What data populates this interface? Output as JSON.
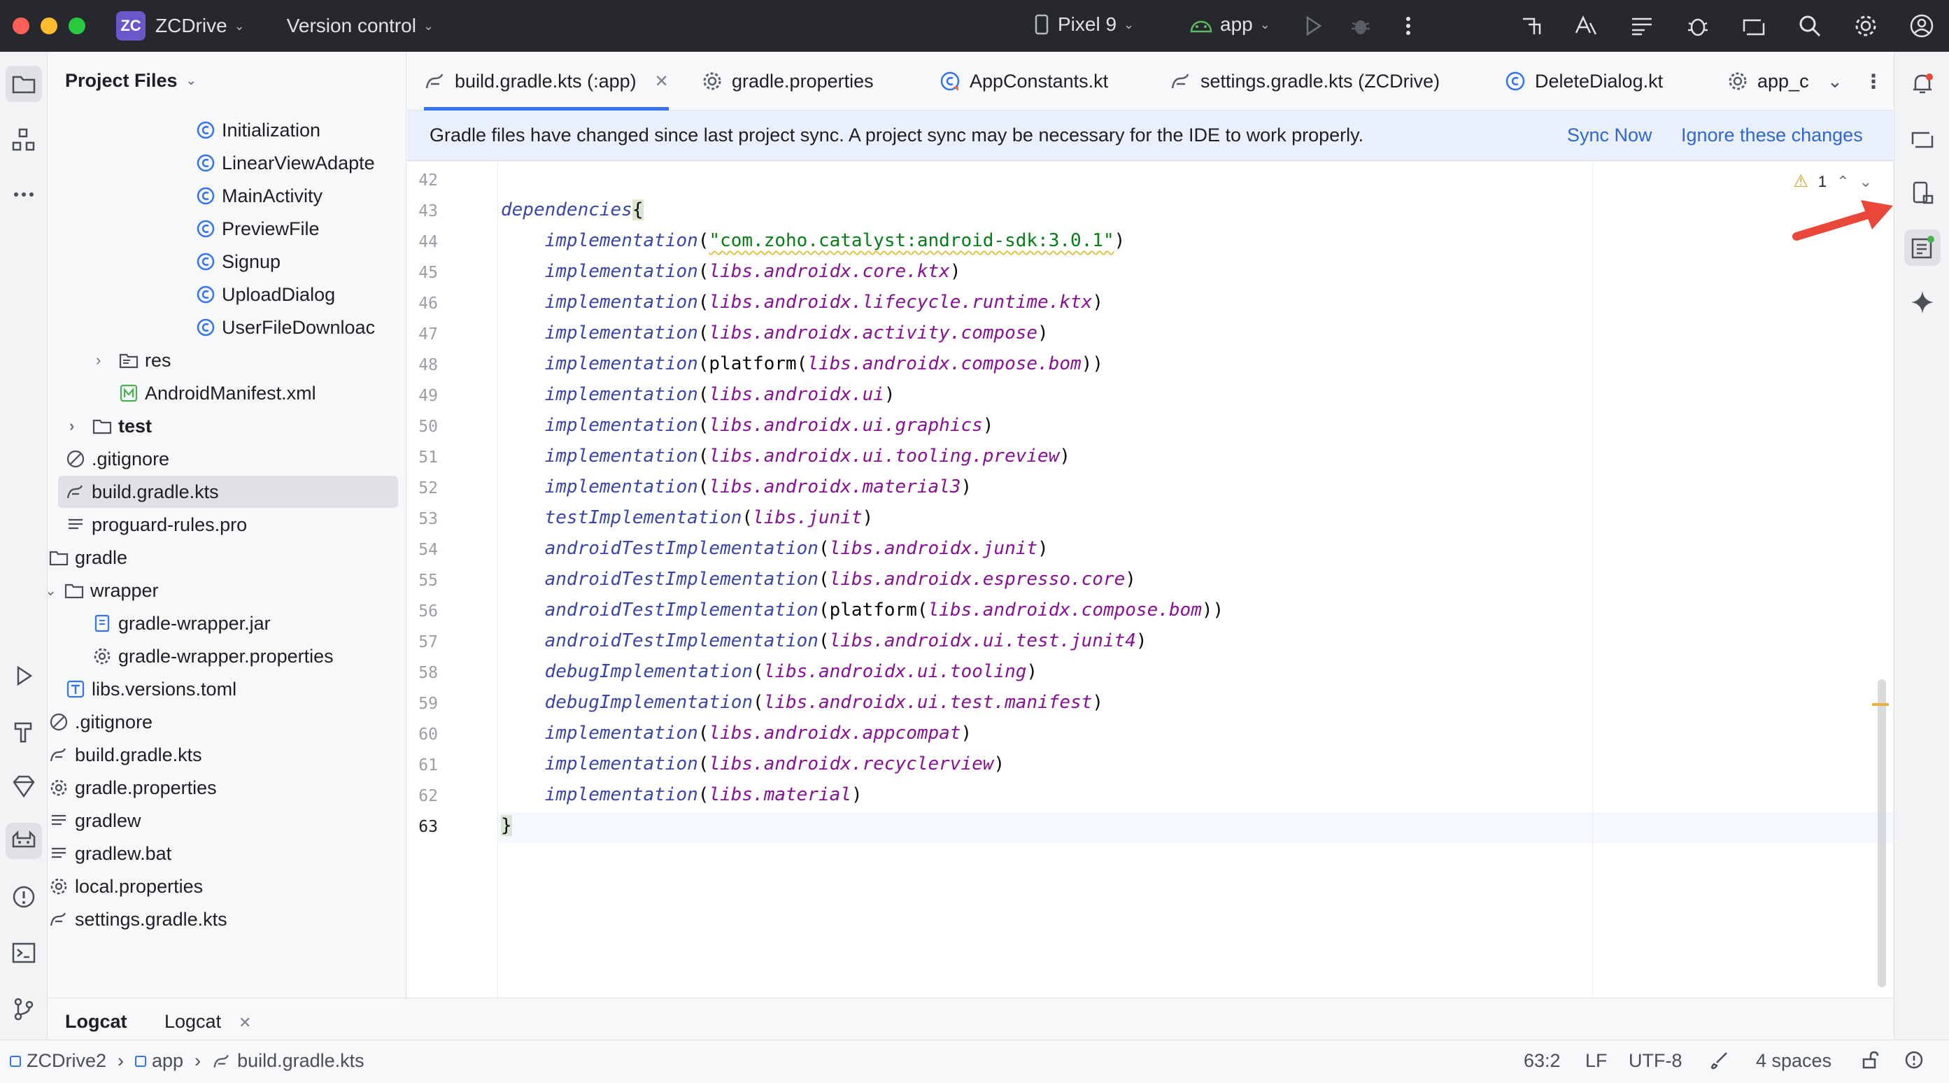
{
  "titlebar": {
    "project_badge": "ZC",
    "project_name": "ZCDrive",
    "vcs_label": "Version control",
    "device": "Pixel 9",
    "run_config": "app"
  },
  "project_panel": {
    "title": "Project Files",
    "tree": [
      {
        "label": "Initialization",
        "icon": "kotlin-class-icon"
      },
      {
        "label": "LinearViewAdapte",
        "icon": "kotlin-class-icon"
      },
      {
        "label": "MainActivity",
        "icon": "kotlin-class-icon"
      },
      {
        "label": "PreviewFile",
        "icon": "kotlin-class-icon"
      },
      {
        "label": "Signup",
        "icon": "kotlin-class-icon"
      },
      {
        "label": "UploadDialog",
        "icon": "kotlin-class-icon"
      },
      {
        "label": "UserFileDownloac",
        "icon": "kotlin-class-icon"
      },
      {
        "label": "res",
        "icon": "resource-folder-icon"
      },
      {
        "label": "AndroidManifest.xml",
        "icon": "manifest-icon"
      },
      {
        "label": "test",
        "icon": "folder-icon"
      },
      {
        "label": ".gitignore",
        "icon": "ignore-file-icon"
      },
      {
        "label": "build.gradle.kts",
        "icon": "gradle-icon"
      },
      {
        "label": "proguard-rules.pro",
        "icon": "text-file-icon"
      },
      {
        "label": "gradle",
        "icon": "folder-icon"
      },
      {
        "label": "wrapper",
        "icon": "folder-icon"
      },
      {
        "label": "gradle-wrapper.jar",
        "icon": "jar-icon"
      },
      {
        "label": "gradle-wrapper.properties",
        "icon": "gear-icon"
      },
      {
        "label": "libs.versions.toml",
        "icon": "toml-icon"
      },
      {
        "label": ".gitignore",
        "icon": "ignore-file-icon"
      },
      {
        "label": "build.gradle.kts",
        "icon": "gradle-icon"
      },
      {
        "label": "gradle.properties",
        "icon": "gear-icon"
      },
      {
        "label": "gradlew",
        "icon": "text-file-icon"
      },
      {
        "label": "gradlew.bat",
        "icon": "text-file-icon"
      },
      {
        "label": "local.properties",
        "icon": "gear-icon"
      },
      {
        "label": "settings.gradle.kts",
        "icon": "gradle-icon"
      }
    ]
  },
  "tabs": [
    {
      "label": "build.gradle.kts (:app)",
      "active": true
    },
    {
      "label": "gradle.properties"
    },
    {
      "label": "AppConstants.kt"
    },
    {
      "label": "settings.gradle.kts (ZCDrive)"
    },
    {
      "label": "DeleteDialog.kt"
    },
    {
      "label": "app_c"
    }
  ],
  "banner": {
    "message": "Gradle files have changed since last project sync. A project sync may be necessary for the IDE to work properly.",
    "sync_now": "Sync Now",
    "ignore": "Ignore these changes"
  },
  "editor": {
    "warning_count": "1",
    "lines": [
      {
        "n": "42",
        "parts": []
      },
      {
        "n": "43",
        "parts": [
          [
            "kw",
            "dependencies"
          ],
          [
            "hl",
            "{"
          ]
        ]
      },
      {
        "n": "44",
        "parts": [
          [
            "i",
            "    "
          ],
          [
            "kw",
            "implementation"
          ],
          [
            "p",
            "("
          ],
          [
            "str",
            "\"com.zoho.catalyst:android-sdk:3.0.1\""
          ],
          [
            "p",
            ")"
          ]
        ]
      },
      {
        "n": "45",
        "parts": [
          [
            "i",
            "    "
          ],
          [
            "kw",
            "implementation"
          ],
          [
            "p",
            "("
          ],
          [
            "prop",
            "libs.androidx.core.ktx"
          ],
          [
            "p",
            ")"
          ]
        ]
      },
      {
        "n": "46",
        "parts": [
          [
            "i",
            "    "
          ],
          [
            "kw",
            "implementation"
          ],
          [
            "p",
            "("
          ],
          [
            "prop",
            "libs.androidx.lifecycle.runtime.ktx"
          ],
          [
            "p",
            ")"
          ]
        ]
      },
      {
        "n": "47",
        "parts": [
          [
            "i",
            "    "
          ],
          [
            "kw",
            "implementation"
          ],
          [
            "p",
            "("
          ],
          [
            "prop",
            "libs.androidx.activity.compose"
          ],
          [
            "p",
            ")"
          ]
        ]
      },
      {
        "n": "48",
        "parts": [
          [
            "i",
            "    "
          ],
          [
            "kw",
            "implementation"
          ],
          [
            "p",
            "(platform("
          ],
          [
            "prop",
            "libs.androidx.compose.bom"
          ],
          [
            "p",
            "))"
          ]
        ]
      },
      {
        "n": "49",
        "parts": [
          [
            "i",
            "    "
          ],
          [
            "kw",
            "implementation"
          ],
          [
            "p",
            "("
          ],
          [
            "prop",
            "libs.androidx.ui"
          ],
          [
            "p",
            ")"
          ]
        ]
      },
      {
        "n": "50",
        "parts": [
          [
            "i",
            "    "
          ],
          [
            "kw",
            "implementation"
          ],
          [
            "p",
            "("
          ],
          [
            "prop",
            "libs.androidx.ui.graphics"
          ],
          [
            "p",
            ")"
          ]
        ]
      },
      {
        "n": "51",
        "parts": [
          [
            "i",
            "    "
          ],
          [
            "kw",
            "implementation"
          ],
          [
            "p",
            "("
          ],
          [
            "prop",
            "libs.androidx.ui.tooling.preview"
          ],
          [
            "p",
            ")"
          ]
        ]
      },
      {
        "n": "52",
        "parts": [
          [
            "i",
            "    "
          ],
          [
            "kw",
            "implementation"
          ],
          [
            "p",
            "("
          ],
          [
            "prop",
            "libs.androidx.material3"
          ],
          [
            "p",
            ")"
          ]
        ]
      },
      {
        "n": "53",
        "parts": [
          [
            "i",
            "    "
          ],
          [
            "kw",
            "testImplementation"
          ],
          [
            "p",
            "("
          ],
          [
            "prop",
            "libs.junit"
          ],
          [
            "p",
            ")"
          ]
        ]
      },
      {
        "n": "54",
        "parts": [
          [
            "i",
            "    "
          ],
          [
            "kw",
            "androidTestImplementation"
          ],
          [
            "p",
            "("
          ],
          [
            "prop",
            "libs.androidx.junit"
          ],
          [
            "p",
            ")"
          ]
        ]
      },
      {
        "n": "55",
        "parts": [
          [
            "i",
            "    "
          ],
          [
            "kw",
            "androidTestImplementation"
          ],
          [
            "p",
            "("
          ],
          [
            "prop",
            "libs.androidx.espresso.core"
          ],
          [
            "p",
            ")"
          ]
        ]
      },
      {
        "n": "56",
        "parts": [
          [
            "i",
            "    "
          ],
          [
            "kw",
            "androidTestImplementation"
          ],
          [
            "p",
            "(platform("
          ],
          [
            "prop",
            "libs.androidx.compose.bom"
          ],
          [
            "p",
            "))"
          ]
        ]
      },
      {
        "n": "57",
        "parts": [
          [
            "i",
            "    "
          ],
          [
            "kw",
            "androidTestImplementation"
          ],
          [
            "p",
            "("
          ],
          [
            "prop",
            "libs.androidx.ui.test.junit4"
          ],
          [
            "p",
            ")"
          ]
        ]
      },
      {
        "n": "58",
        "parts": [
          [
            "i",
            "    "
          ],
          [
            "kw",
            "debugImplementation"
          ],
          [
            "p",
            "("
          ],
          [
            "prop",
            "libs.androidx.ui.tooling"
          ],
          [
            "p",
            ")"
          ]
        ]
      },
      {
        "n": "59",
        "parts": [
          [
            "i",
            "    "
          ],
          [
            "kw",
            "debugImplementation"
          ],
          [
            "p",
            "("
          ],
          [
            "prop",
            "libs.androidx.ui.test.manifest"
          ],
          [
            "p",
            ")"
          ]
        ]
      },
      {
        "n": "60",
        "parts": [
          [
            "i",
            "    "
          ],
          [
            "kw",
            "implementation"
          ],
          [
            "p",
            "("
          ],
          [
            "prop",
            "libs.androidx.appcompat"
          ],
          [
            "p",
            ")"
          ]
        ]
      },
      {
        "n": "61",
        "parts": [
          [
            "i",
            "    "
          ],
          [
            "kw",
            "implementation"
          ],
          [
            "p",
            "("
          ],
          [
            "prop",
            "libs.androidx.recyclerview"
          ],
          [
            "p",
            ")"
          ]
        ]
      },
      {
        "n": "62",
        "parts": [
          [
            "i",
            "    "
          ],
          [
            "kw",
            "implementation"
          ],
          [
            "p",
            "("
          ],
          [
            "prop",
            "libs.material"
          ],
          [
            "p",
            ")"
          ]
        ]
      },
      {
        "n": "63",
        "parts": [
          [
            "hl",
            "}"
          ]
        ]
      }
    ]
  },
  "bottom_tabs": [
    "Logcat",
    "Logcat"
  ],
  "statusbar": {
    "breadcrumb": [
      "ZCDrive2",
      "app",
      "build.gradle.kts"
    ],
    "position": "63:2",
    "line_sep": "LF",
    "encoding": "UTF-8",
    "indent": "4 spaces"
  },
  "colors": {
    "accent": "#3574f0",
    "keyword": "#3b45a8",
    "property": "#871094",
    "string": "#067d17",
    "link": "#2f66d0",
    "annotation_arrow": "#e8473a"
  }
}
